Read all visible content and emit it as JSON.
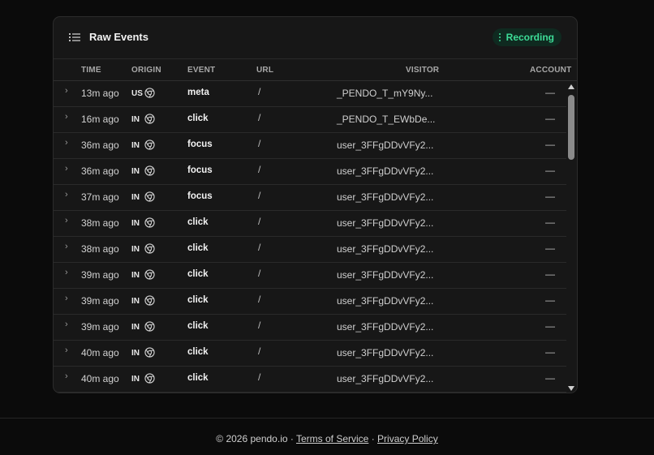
{
  "panel": {
    "title": "Raw Events",
    "status": "Recording",
    "title_icon": "list-icon",
    "status_icon": "vertical-dots-icon",
    "accent": "#3ddc97"
  },
  "columns": {
    "time": "TIME",
    "origin": "ORIGIN",
    "event": "EVENT",
    "url": "URL",
    "visitor": "VISITOR",
    "account": "ACCOUNT"
  },
  "rows": [
    {
      "time": "13m ago",
      "origin": "US",
      "browser": "chrome-icon",
      "event": "meta",
      "url": "/",
      "visitor": "_PENDO_T_mY9Ny...",
      "account": "—"
    },
    {
      "time": "16m ago",
      "origin": "IN",
      "browser": "chrome-icon",
      "event": "click",
      "url": "/",
      "visitor": "_PENDO_T_EWbDe...",
      "account": "—"
    },
    {
      "time": "36m ago",
      "origin": "IN",
      "browser": "chrome-icon",
      "event": "focus",
      "url": "/",
      "visitor": "user_3FFgDDvVFy2...",
      "account": "—"
    },
    {
      "time": "36m ago",
      "origin": "IN",
      "browser": "chrome-icon",
      "event": "focus",
      "url": "/",
      "visitor": "user_3FFgDDvVFy2...",
      "account": "—"
    },
    {
      "time": "37m ago",
      "origin": "IN",
      "browser": "chrome-icon",
      "event": "focus",
      "url": "/",
      "visitor": "user_3FFgDDvVFy2...",
      "account": "—"
    },
    {
      "time": "38m ago",
      "origin": "IN",
      "browser": "chrome-icon",
      "event": "click",
      "url": "/",
      "visitor": "user_3FFgDDvVFy2...",
      "account": "—"
    },
    {
      "time": "38m ago",
      "origin": "IN",
      "browser": "chrome-icon",
      "event": "click",
      "url": "/",
      "visitor": "user_3FFgDDvVFy2...",
      "account": "—"
    },
    {
      "time": "39m ago",
      "origin": "IN",
      "browser": "chrome-icon",
      "event": "click",
      "url": "/",
      "visitor": "user_3FFgDDvVFy2...",
      "account": "—"
    },
    {
      "time": "39m ago",
      "origin": "IN",
      "browser": "chrome-icon",
      "event": "click",
      "url": "/",
      "visitor": "user_3FFgDDvVFy2...",
      "account": "—"
    },
    {
      "time": "39m ago",
      "origin": "IN",
      "browser": "chrome-icon",
      "event": "click",
      "url": "/",
      "visitor": "user_3FFgDDvVFy2...",
      "account": "—"
    },
    {
      "time": "40m ago",
      "origin": "IN",
      "browser": "chrome-icon",
      "event": "click",
      "url": "/",
      "visitor": "user_3FFgDDvVFy2...",
      "account": "—"
    },
    {
      "time": "40m ago",
      "origin": "IN",
      "browser": "chrome-icon",
      "event": "click",
      "url": "/",
      "visitor": "user_3FFgDDvVFy2...",
      "account": "—"
    }
  ],
  "footer": {
    "copyright": "© 2026 pendo.io ·",
    "terms": "Terms of Service",
    "separator": "·",
    "privacy": "Privacy Policy"
  }
}
